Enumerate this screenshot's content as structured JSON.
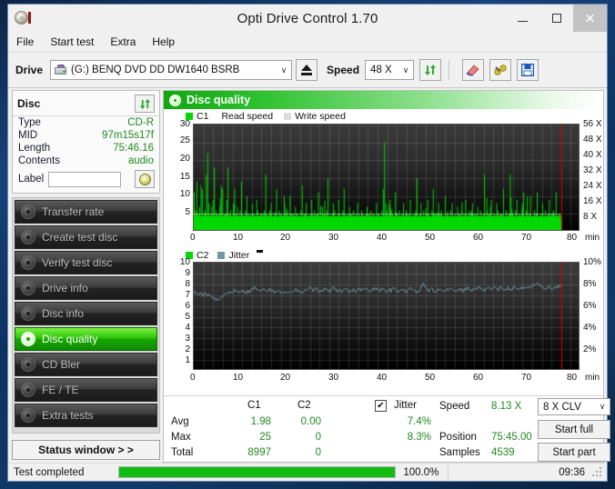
{
  "window": {
    "title": "Opti Drive Control 1.70",
    "app_icon": "disc-icon",
    "minimize": "minimize-icon",
    "maximize": "maximize-icon",
    "close": "✕"
  },
  "menubar": {
    "items": [
      {
        "label": "File"
      },
      {
        "label": "Start test"
      },
      {
        "label": "Extra"
      },
      {
        "label": "Help"
      }
    ]
  },
  "toolbar": {
    "drive_label": "Drive",
    "drive_value": "(G:)   BENQ DVD DD DW1640 BSRB",
    "eject_icon": "eject-icon",
    "speed_label": "Speed",
    "speed_value": "48 X",
    "refresh_icon": "refresh-arrows-icon",
    "erase_icon": "eraser-icon",
    "tools_icon": "tools-icon",
    "save_icon": "save-disk-icon"
  },
  "disc_panel": {
    "title": "Disc",
    "refresh_icon": "refresh-arrows-icon",
    "rows": [
      {
        "key": "Type",
        "value": "CD-R"
      },
      {
        "key": "MID",
        "value": "97m15s17f"
      },
      {
        "key": "Length",
        "value": "75:46.16"
      },
      {
        "key": "Contents",
        "value": "audio"
      }
    ],
    "label_key": "Label",
    "label_value": "",
    "label_placeholder": "",
    "disc_button_icon": "disc-icon"
  },
  "nav": {
    "items": [
      {
        "label": "Transfer rate",
        "icon": "disc-icon",
        "active": false
      },
      {
        "label": "Create test disc",
        "icon": "disc-icon",
        "active": false
      },
      {
        "label": "Verify test disc",
        "icon": "disc-icon",
        "active": false
      },
      {
        "label": "Drive info",
        "icon": "disc-icon",
        "active": false
      },
      {
        "label": "Disc info",
        "icon": "disc-icon",
        "active": false
      },
      {
        "label": "Disc quality",
        "icon": "disc-icon",
        "active": true
      },
      {
        "label": "CD Bler",
        "icon": "disc-icon",
        "active": false
      },
      {
        "label": "FE / TE",
        "icon": "disc-icon",
        "active": false
      },
      {
        "label": "Extra tests",
        "icon": "disc-icon",
        "active": false
      }
    ],
    "status_window_button": "Status window > >"
  },
  "panel_header": {
    "title": "Disc quality",
    "icon": "disc-icon"
  },
  "stats": {
    "col_c1": "C1",
    "col_c2": "C2",
    "row_avg": "Avg",
    "row_max": "Max",
    "row_total": "Total",
    "c1": {
      "avg": "1.98",
      "max": "25",
      "total": "8997"
    },
    "c2": {
      "avg": "0.00",
      "max": "0",
      "total": "0"
    },
    "jitter_label": "Jitter",
    "jitter_checked": "✔",
    "jitter_avg": "7.4%",
    "jitter_max": "8.3%",
    "speed_label": "Speed",
    "speed_value": "8.13 X",
    "position_label": "Position",
    "position_value": "75:45.00",
    "samples_label": "Samples",
    "samples_value": "4539",
    "speed_mode": "8 X CLV",
    "start_full": "Start full",
    "start_part": "Start part"
  },
  "statusbar": {
    "message": "Test completed",
    "progress_pct_label": "100.0%",
    "progress_value": 100,
    "clock": "09:36"
  },
  "colors": {
    "accent_green": "#17a800",
    "value_green": "#1f8a1f",
    "c1_green": "#00d800",
    "jitter_teal": "#6f9ba6",
    "cursor_red": "#e00000",
    "read_speed_white": "#ffffff",
    "title_bg": "#f0f0f0"
  },
  "chart_data": [
    {
      "type": "bar",
      "name": "C1 errors and read speed",
      "title": "",
      "legend": [
        {
          "label": "C1",
          "color": "#00d800"
        },
        {
          "label": "Read speed",
          "color": "#ffffff"
        },
        {
          "label": "Write speed",
          "color": "#d8d8d8"
        }
      ],
      "xlabel": "min",
      "ylabel": "C1",
      "y2label": "X",
      "xlim": [
        0,
        80
      ],
      "ylim": [
        0,
        30
      ],
      "y2lim": [
        0,
        56
      ],
      "xticks": [
        0,
        10,
        20,
        30,
        40,
        50,
        60,
        70,
        80
      ],
      "yticks": [
        5,
        10,
        15,
        20,
        25,
        30
      ],
      "y2ticks": [
        "8 X",
        "16 X",
        "24 X",
        "32 X",
        "40 X",
        "48 X",
        "56 X"
      ],
      "grid": true,
      "cursor_x": 76,
      "read_speed_series": {
        "name": "Read speed",
        "constant_value": 8.13,
        "color": "#ffffff",
        "style": "dotted"
      },
      "series": [
        {
          "name": "C1",
          "color": "#00d800",
          "x_start": 0,
          "x_end": 76,
          "values": [
            11,
            6,
            14,
            5,
            7,
            13,
            12,
            4,
            6,
            16,
            22,
            8,
            5,
            7,
            9,
            18,
            6,
            5,
            4,
            7,
            13,
            12,
            4,
            5,
            9,
            18,
            5,
            6,
            4,
            8,
            12,
            5,
            7,
            4,
            6,
            14,
            5,
            4,
            6,
            10,
            5,
            4,
            3,
            8,
            5,
            4,
            3,
            6,
            4,
            5,
            3,
            4,
            6,
            16,
            5,
            4,
            6,
            8,
            4,
            3,
            5,
            12,
            4,
            6,
            5,
            3,
            4,
            8,
            5,
            6,
            4,
            10,
            5,
            3,
            4,
            7,
            5,
            4,
            3,
            6,
            13,
            4,
            5,
            8,
            4,
            3,
            5,
            9,
            4,
            6,
            3,
            5,
            11,
            4,
            3,
            7,
            5,
            4,
            6,
            15,
            4,
            3,
            5,
            8,
            6,
            4,
            3,
            9,
            5,
            4,
            6,
            12,
            3,
            5,
            4,
            7,
            5,
            3,
            6,
            4,
            5,
            8,
            3,
            4,
            6,
            5,
            4,
            3,
            7,
            5,
            4,
            6,
            3,
            5,
            4,
            8,
            5,
            3,
            4,
            6,
            12,
            25,
            8,
            4,
            5,
            9,
            6,
            3,
            4,
            11,
            5,
            4,
            6,
            3,
            5,
            8,
            4,
            6,
            3,
            5,
            9,
            4,
            5,
            3,
            6,
            15,
            4,
            5,
            8,
            3,
            6,
            4,
            5,
            9,
            3,
            4,
            6,
            12,
            5,
            3,
            4,
            8,
            5,
            6,
            3,
            4,
            10,
            5,
            4,
            3,
            6,
            8,
            4,
            5,
            3,
            7,
            5,
            4,
            6,
            3,
            5,
            9,
            4,
            3,
            6,
            5,
            8,
            4,
            3,
            5,
            7,
            4,
            6,
            3,
            5,
            16,
            4,
            6,
            3,
            5,
            9,
            4,
            5,
            3,
            8,
            6,
            4,
            3,
            5,
            12,
            4,
            6,
            3,
            5,
            16,
            4,
            5,
            3,
            6,
            9,
            4,
            5,
            3,
            8,
            11,
            4,
            6,
            3,
            5,
            10,
            4,
            3,
            6,
            5,
            11,
            4,
            3,
            5,
            8,
            4,
            6,
            3,
            5,
            9,
            4,
            3,
            6,
            5,
            11,
            4,
            3,
            5
          ]
        }
      ]
    },
    {
      "type": "line",
      "name": "C2 errors and jitter",
      "title": "",
      "legend": [
        {
          "label": "C2",
          "color": "#00d800"
        },
        {
          "label": "Jitter",
          "color": "#6f9ba6"
        }
      ],
      "xlabel": "min",
      "ylabel": "C2",
      "y2label": "%",
      "xlim": [
        0,
        80
      ],
      "ylim": [
        0,
        10
      ],
      "y2lim": [
        0,
        10
      ],
      "xticks": [
        0,
        10,
        20,
        30,
        40,
        50,
        60,
        70,
        80
      ],
      "yticks": [
        1,
        2,
        3,
        4,
        5,
        6,
        7,
        8,
        9,
        10
      ],
      "y2ticks": [
        "2%",
        "4%",
        "6%",
        "8%",
        "10%"
      ],
      "grid": true,
      "cursor_x": 76,
      "series": [
        {
          "name": "Jitter",
          "color": "#6f9ba6",
          "x_start": 0,
          "x_end": 76,
          "avg": 7.4,
          "max": 8.3,
          "values": [
            7.3,
            7.2,
            7.1,
            7.2,
            7.0,
            7.1,
            7.0,
            6.9,
            7.0,
            6.8,
            6.7,
            6.6,
            6.5,
            6.7,
            6.9,
            7.1,
            7.2,
            7.2,
            7.3,
            7.2,
            7.4,
            7.3,
            7.2,
            7.4,
            7.5,
            7.3,
            7.2,
            7.4,
            7.3,
            7.5,
            7.7,
            7.6,
            7.4,
            7.3,
            7.5,
            7.6,
            7.4,
            7.3,
            7.5,
            7.4,
            7.3,
            7.2,
            7.4,
            7.3,
            7.2,
            7.3,
            7.4,
            7.3,
            7.2,
            7.4,
            7.3,
            7.5,
            7.4,
            7.3,
            7.2,
            7.3,
            7.4,
            7.6,
            7.7,
            7.5,
            7.4,
            7.6,
            7.5,
            7.3,
            7.4,
            7.5,
            7.6,
            7.4,
            7.3,
            7.5,
            7.8,
            7.6,
            7.4,
            7.5,
            7.3,
            7.4,
            7.6,
            7.5,
            7.3,
            7.4,
            7.5,
            7.3,
            7.4,
            7.6,
            7.5,
            7.4,
            7.6,
            7.5,
            7.3,
            7.4,
            7.5,
            7.7,
            7.6,
            7.4,
            7.5,
            7.6,
            7.4,
            7.3,
            7.5,
            7.4,
            7.6,
            7.5,
            7.3,
            7.4,
            7.6,
            7.5,
            7.4,
            7.3,
            7.5,
            7.6,
            7.4,
            7.5,
            7.3,
            7.4,
            7.6,
            8.1,
            7.8,
            7.5,
            7.4,
            7.6,
            7.5,
            7.3,
            7.4,
            7.5,
            7.6,
            7.4,
            7.3,
            7.5,
            7.4,
            7.6,
            7.5,
            7.4,
            7.3,
            7.5,
            7.6,
            7.4,
            7.5,
            7.6,
            7.7,
            7.5,
            7.4,
            7.6,
            7.5,
            7.7,
            7.6,
            7.5,
            7.4,
            7.6,
            7.7,
            7.5,
            7.6,
            7.8,
            7.6,
            7.5,
            7.7,
            7.6,
            7.5,
            7.6,
            7.7,
            7.5,
            7.6,
            7.8,
            7.7,
            7.5,
            7.6,
            7.7,
            7.6,
            7.8,
            7.7,
            7.6,
            7.8,
            8.0,
            7.9,
            8.2,
            8.0,
            7.8,
            7.7,
            7.6,
            7.8,
            7.7,
            7.5,
            7.6,
            7.8,
            7.7,
            7.9,
            7.8
          ]
        },
        {
          "name": "C2",
          "color": "#00d800",
          "values": []
        }
      ]
    }
  ]
}
